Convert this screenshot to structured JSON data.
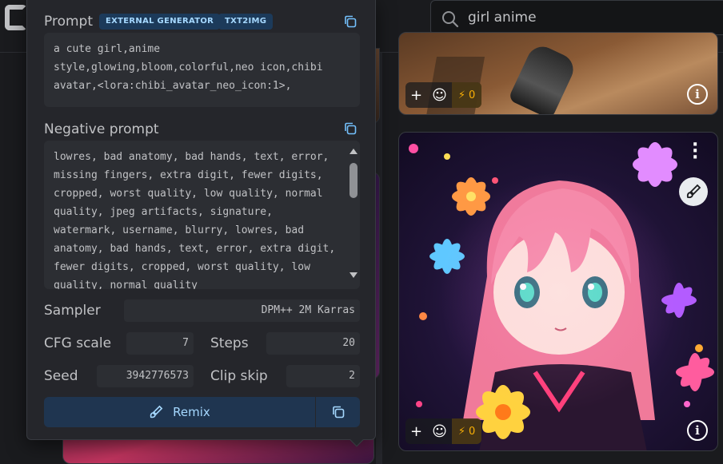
{
  "search": {
    "value": "girl anime"
  },
  "panel": {
    "prompt_title": "Prompt",
    "badges": [
      "EXTERNAL GENERATOR",
      "TXT2IMG"
    ],
    "prompt_text": "a cute girl,anime style,glowing,bloom,colorful,neo icon,chibi avatar,<lora:chibi_avatar_neo_icon:1>,",
    "negative_title": "Negative prompt",
    "negative_text": "lowres, bad anatomy, bad hands, text, error, missing fingers, extra digit, fewer digits, cropped, worst quality, low quality, normal quality, jpeg artifacts, signature, watermark, username, blurry, lowres, bad anatomy, bad hands, text, error, extra digit, fewer digits, cropped, worst quality, low quality, normal quality",
    "sampler_label": "Sampler",
    "sampler_value": "DPM++ 2M Karras",
    "cfg_label": "CFG scale",
    "cfg_value": "7",
    "steps_label": "Steps",
    "steps_value": "20",
    "seed_label": "Seed",
    "seed_value": "3942776573",
    "clip_label": "Clip skip",
    "clip_value": "2",
    "remix_label": "Remix"
  },
  "cards": {
    "top": {
      "reactions_count": "0"
    },
    "main": {
      "reactions_count": "0"
    }
  },
  "icons": [
    "search-icon",
    "copy-icon",
    "brush-icon",
    "plus-icon",
    "smile-icon",
    "bolt-icon",
    "info-icon",
    "kebab-icon",
    "scroll-up-icon",
    "scroll-down-icon"
  ],
  "colors": {
    "panel_bg": "#25262b",
    "badge_bg": "#1c3a5a",
    "badge_text": "#a5d8ff",
    "remix_bg": "#1f3550",
    "bolt": "#fab005"
  }
}
